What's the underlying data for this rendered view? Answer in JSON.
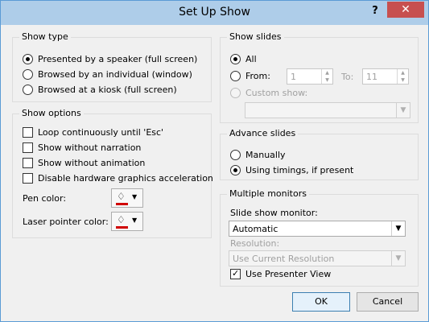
{
  "window": {
    "title": "Set Up Show",
    "help": "?",
    "close": "✕"
  },
  "show_type": {
    "label": "Show type",
    "options": [
      {
        "label": "Presented by a speaker (full screen)",
        "selected": true
      },
      {
        "label": "Browsed by an individual (window)",
        "selected": false
      },
      {
        "label": "Browsed at a kiosk (full screen)",
        "selected": false
      }
    ]
  },
  "show_options": {
    "label": "Show options",
    "checks": [
      {
        "label": "Loop continuously until 'Esc'",
        "checked": false
      },
      {
        "label": "Show without narration",
        "checked": false
      },
      {
        "label": "Show without animation",
        "checked": false
      },
      {
        "label": "Disable hardware graphics acceleration",
        "checked": false
      }
    ],
    "pen_color_label": "Pen color:",
    "pen_color": "#d00000",
    "laser_color_label": "Laser pointer color:",
    "laser_color": "#d00000"
  },
  "show_slides": {
    "label": "Show slides",
    "all": "All",
    "from": "From:",
    "from_value": "1",
    "to": "To:",
    "to_value": "11",
    "custom": "Custom show:",
    "selected": "All"
  },
  "advance_slides": {
    "label": "Advance slides",
    "manually": "Manually",
    "timings": "Using timings, if present",
    "selected": "Using timings, if present"
  },
  "monitors": {
    "label": "Multiple monitors",
    "monitor_label": "Slide show monitor:",
    "monitor_value": "Automatic",
    "resolution_label": "Resolution:",
    "resolution_value": "Use Current Resolution",
    "presenter_view": "Use Presenter View",
    "presenter_view_checked": true
  },
  "buttons": {
    "ok": "OK",
    "cancel": "Cancel"
  }
}
